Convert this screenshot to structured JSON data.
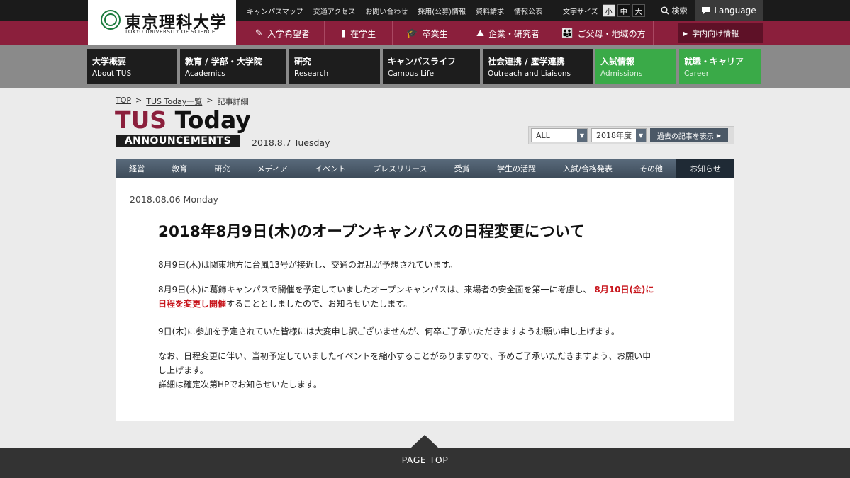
{
  "header": {
    "logo_jp": "東京理科大学",
    "logo_en": "TOKYO UNIVERSITY OF SCIENCE",
    "top_links": [
      "キャンパスマップ",
      "交通アクセス",
      "お問い合わせ",
      "採用(公募)情報",
      "資料請求",
      "情報公表"
    ],
    "font_size_label": "文字サイズ",
    "font_sizes": [
      "小",
      "中",
      "大"
    ],
    "search_label": "検索",
    "language_label": "Language"
  },
  "audience": {
    "items": [
      {
        "icon": "✎",
        "label": "入学希望者"
      },
      {
        "icon": "▮",
        "label": "在学生"
      },
      {
        "icon": "🎓",
        "label": "卒業生"
      },
      {
        "icon": "⛰",
        "label": "企業・研究者"
      },
      {
        "icon": "👪",
        "label": "ご父母・地域の方"
      }
    ],
    "campus_label": "学内向け情報"
  },
  "main_nav": [
    {
      "jp": "大学概要",
      "en": "About TUS"
    },
    {
      "jp": "教育 / 学部・大学院",
      "en": "Academics"
    },
    {
      "jp": "研究",
      "en": "Research"
    },
    {
      "jp": "キャンパスライフ",
      "en": "Campus Life"
    },
    {
      "jp": "社会連携 / 産学連携",
      "en": "Outreach and Liaisons"
    },
    {
      "jp": "入試情報",
      "en": "Admissions"
    },
    {
      "jp": "就職・キャリア",
      "en": "Career"
    }
  ],
  "breadcrumb": {
    "top": "TOP",
    "sep": ">",
    "list": "TUS Today一覧",
    "current": "記事詳細"
  },
  "section": {
    "title_tus": "TUS",
    "title_today": "Today",
    "badge": "ANNOUNCEMENTS",
    "date": "2018.8.7 Tuesday"
  },
  "filters": {
    "category": "ALL",
    "year": "2018年度",
    "past_button": "過去の記事を表示"
  },
  "categories": [
    "経営",
    "教育",
    "研究",
    "メディア",
    "イベント",
    "プレスリリース",
    "受賞",
    "学生の活躍",
    "入試/合格発表",
    "その他",
    "お知らせ"
  ],
  "article": {
    "date": "2018.08.06 Monday",
    "title": "2018年8月9日(木)のオープンキャンパスの日程変更について",
    "p1": "8月9日(木)は関東地方に台風13号が接近し、交通の混乱が予想されています。",
    "p2_line1": "8月9日(木)に葛飾キャンパスで開催を予定していましたオープンキャンパスは、来場者の安全面を第一に考慮し、",
    "p2_red1": "8月10日(金)に",
    "p2_red2": "日程を変更し開催",
    "p2_rest": "することとしましたので、お知らせいたします。",
    "p3": "9日(木)に参加を予定されていた皆様には大変申し訳ございませんが、何卒ご了承いただきますようお願い申し上げます。",
    "p4_line1": "なお、日程変更に伴い、当初予定していましたイベントを縮小することがありますので、予めご了承いただきますよう、お願い申",
    "p4_line2": "し上げます。",
    "p4_line3": "詳細は確定次第HPでお知らせいたします。"
  },
  "footer": {
    "page_top": "PAGE TOP"
  }
}
